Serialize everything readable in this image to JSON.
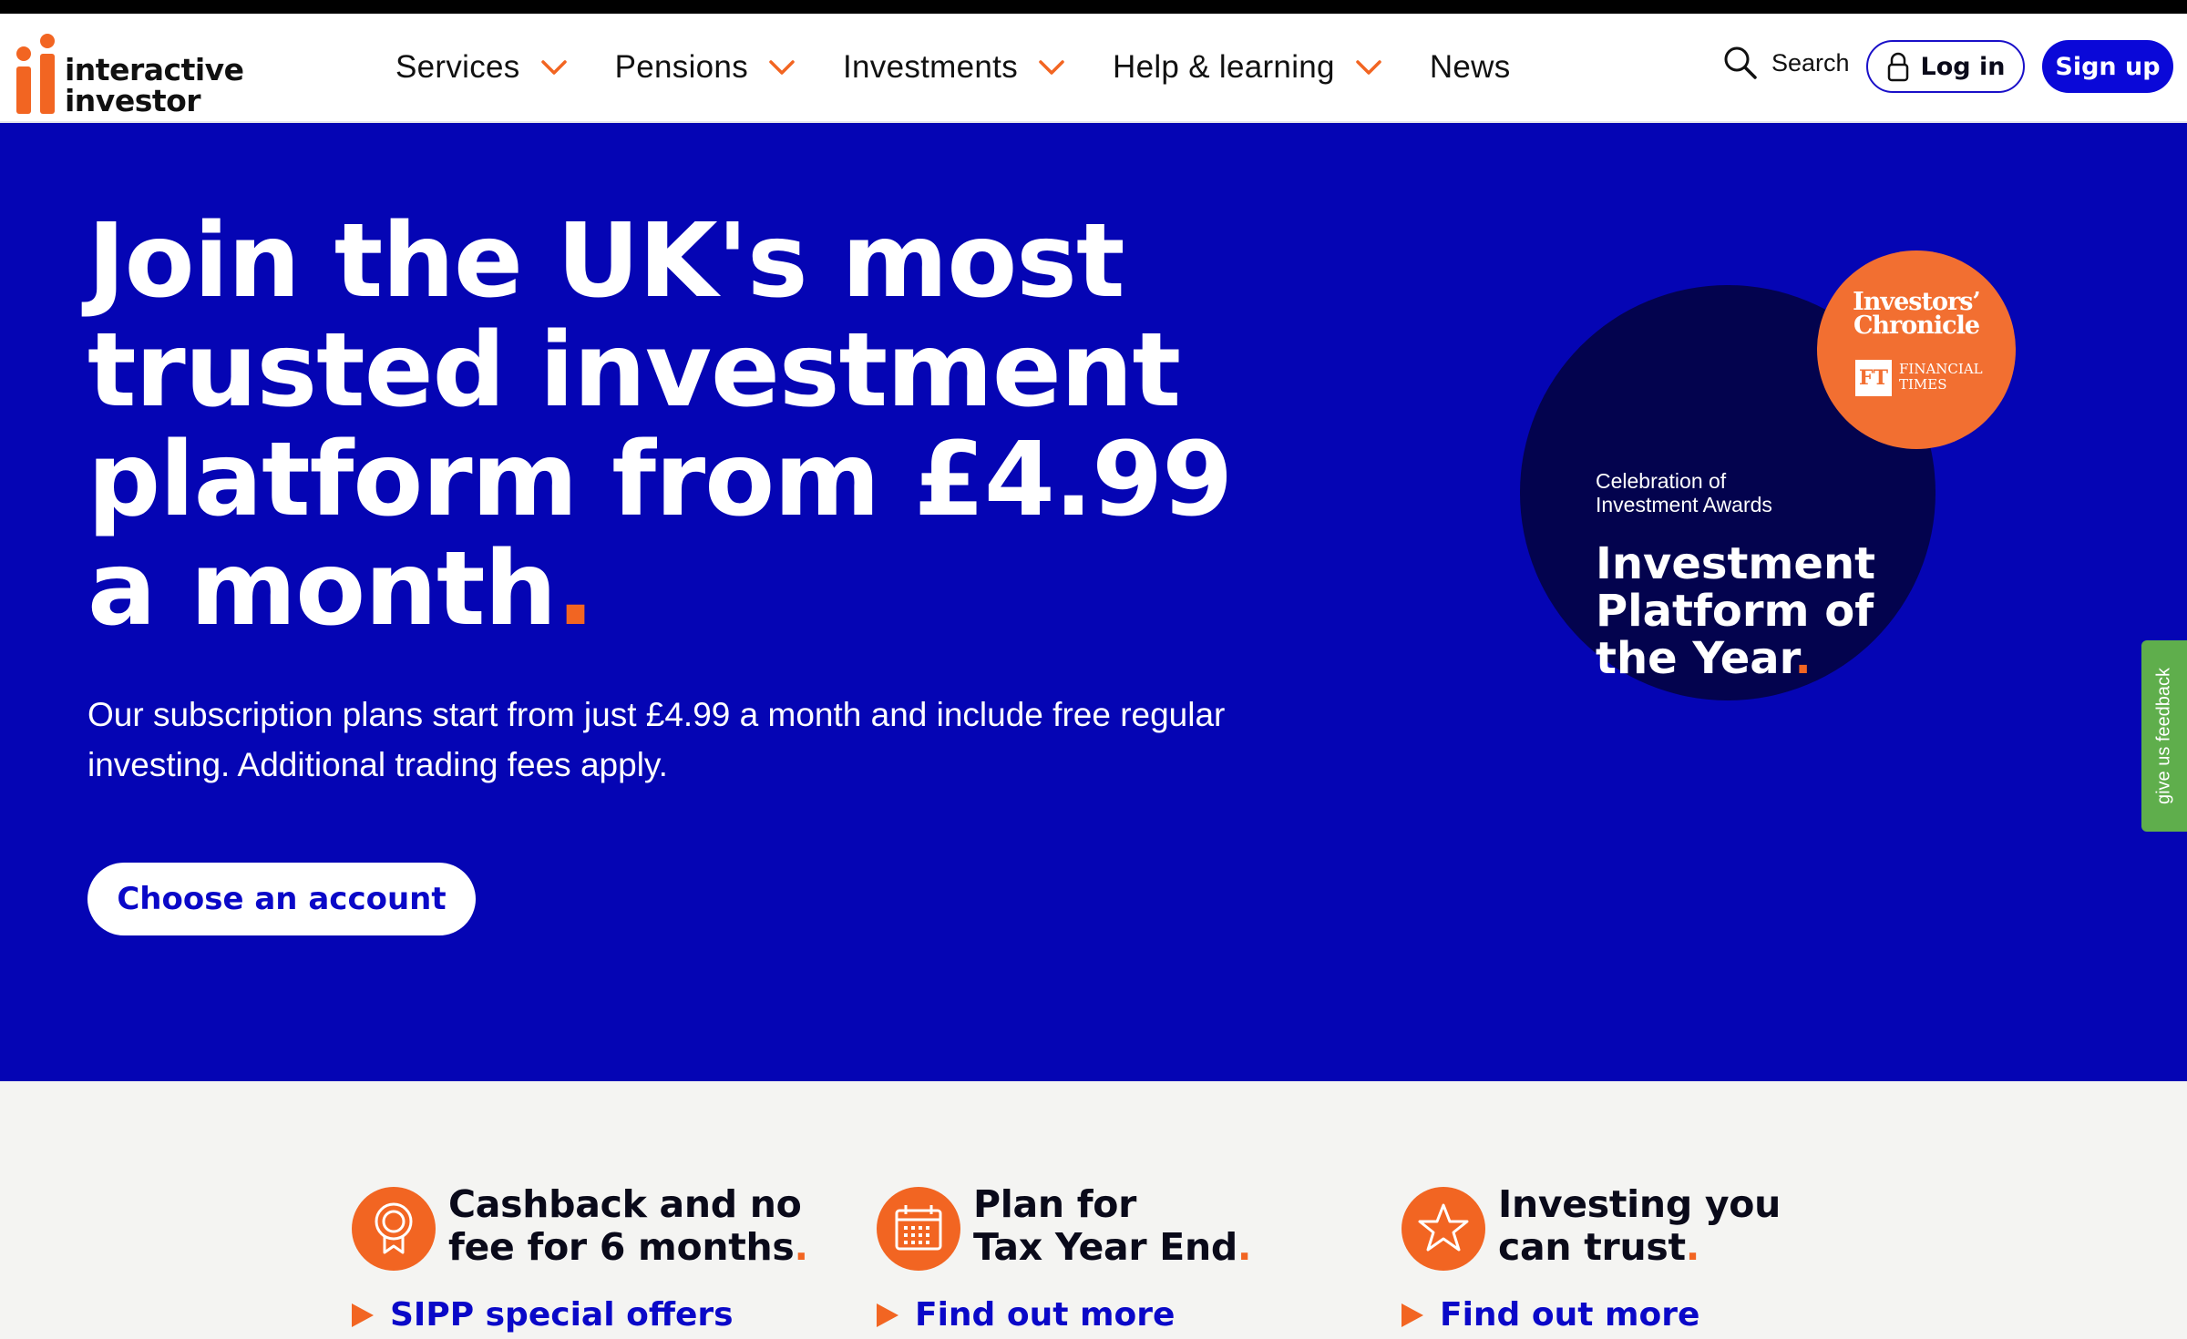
{
  "brand": {
    "line1": "interactive",
    "line2": "investor",
    "accent": "#f26522",
    "primary": "#0505b4"
  },
  "nav": {
    "items": [
      {
        "label": "Services",
        "has_dropdown": true
      },
      {
        "label": "Pensions",
        "has_dropdown": true
      },
      {
        "label": "Investments",
        "has_dropdown": true
      },
      {
        "label": "Help & learning",
        "has_dropdown": true
      },
      {
        "label": "News",
        "has_dropdown": false
      }
    ],
    "search_label": "Search",
    "login_label": "Log in",
    "signup_label": "Sign up"
  },
  "hero": {
    "headline": "Join the UK's most trusted investment platform from £4.99 a month",
    "headline_dot": ".",
    "subtext": "Our subscription plans start from just £4.99 a month and include free regular investing. Additional trading fees apply.",
    "cta_label": "Choose an account"
  },
  "award": {
    "line1": "Celebration of",
    "line2": "Investment Awards",
    "title_l1": "Investment",
    "title_l2": "Platform of",
    "title_l3": "the Year",
    "title_dot": ".",
    "badge_l1": "Investors’",
    "badge_l2": "Chronicle",
    "ft_mark": "FT",
    "ft_l1": "FINANCIAL",
    "ft_l2": "TIMES"
  },
  "feedback_label": "give us feedback",
  "features": [
    {
      "icon": "award-ribbon-icon",
      "title_l1": "Cashback and no",
      "title_l2": "fee for 6 months",
      "dot": ".",
      "link": "SIPP special offers"
    },
    {
      "icon": "calendar-icon",
      "title_l1": "Plan for",
      "title_l2": "Tax Year End",
      "dot": ".",
      "link": "Find out more"
    },
    {
      "icon": "star-icon",
      "title_l1": "Investing you",
      "title_l2": "can trust",
      "dot": ".",
      "link": "Find out more"
    }
  ]
}
